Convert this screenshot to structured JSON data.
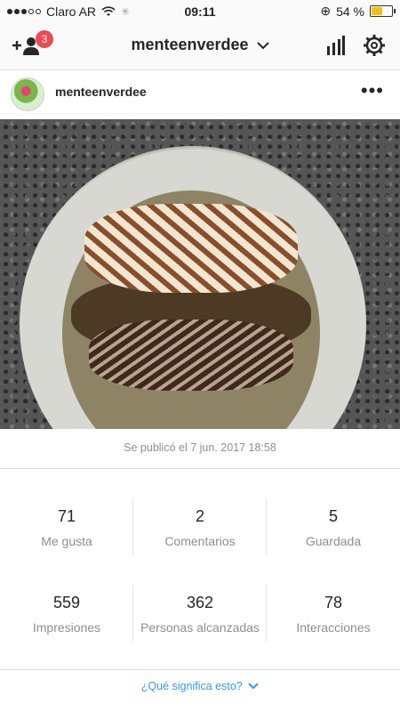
{
  "status_bar": {
    "carrier": "Claro AR",
    "time": "09:11",
    "battery": "54 %",
    "battery_level": 0.54
  },
  "nav": {
    "title": "menteenverdee",
    "follow_requests_badge": "3",
    "icons": [
      "add-person-icon",
      "chevron-down-icon",
      "bar-chart-icon",
      "gear-icon"
    ]
  },
  "post": {
    "username": "menteenverdee",
    "more": "•••"
  },
  "insights": {
    "published": "Se publicó el 7 jun. 2017 18:58",
    "row1": [
      {
        "value": "71",
        "label": "Me gusta"
      },
      {
        "value": "2",
        "label": "Comentarios"
      },
      {
        "value": "5",
        "label": "Guardada"
      }
    ],
    "row2": [
      {
        "value": "559",
        "label": "Impresiones"
      },
      {
        "value": "362",
        "label": "Personas alcanzadas"
      },
      {
        "value": "78",
        "label": "Interacciones"
      }
    ],
    "help_link": "¿Qué significa esto?"
  },
  "colors": {
    "accent_blue": "#3897f0",
    "badge_red": "#ed4956",
    "battery_yellow": "#f4c20d"
  }
}
